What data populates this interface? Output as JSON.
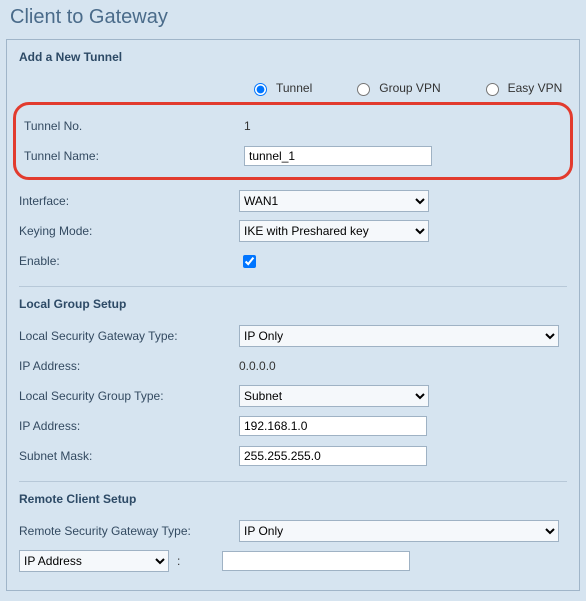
{
  "page_title": "Client to Gateway",
  "add_tunnel": {
    "heading": "Add a New Tunnel",
    "radios": {
      "tunnel": "Tunnel",
      "group_vpn": "Group VPN",
      "easy_vpn": "Easy VPN"
    },
    "tunnel_no": {
      "label": "Tunnel No.",
      "value": "1"
    },
    "tunnel_name": {
      "label": "Tunnel Name:",
      "value": "tunnel_1"
    },
    "interface": {
      "label": "Interface:",
      "value": "WAN1"
    },
    "keying_mode": {
      "label": "Keying Mode:",
      "value": "IKE with Preshared key"
    },
    "enable": {
      "label": "Enable:"
    }
  },
  "local_group": {
    "heading": "Local Group Setup",
    "gw_type": {
      "label": "Local Security Gateway Type:",
      "value": "IP Only"
    },
    "ip1": {
      "label": "IP Address:",
      "value": "0.0.0.0"
    },
    "grp_type": {
      "label": "Local Security Group Type:",
      "value": "Subnet"
    },
    "ip2": {
      "label": "IP Address:",
      "value": "192.168.1.0"
    },
    "mask": {
      "label": "Subnet Mask:",
      "value": "255.255.255.0"
    }
  },
  "remote_client": {
    "heading": "Remote Client Setup",
    "gw_type": {
      "label": "Remote Security Gateway Type:",
      "value": "IP Only"
    },
    "mode": {
      "value": "IP Address"
    },
    "ip": {
      "value": ""
    }
  }
}
